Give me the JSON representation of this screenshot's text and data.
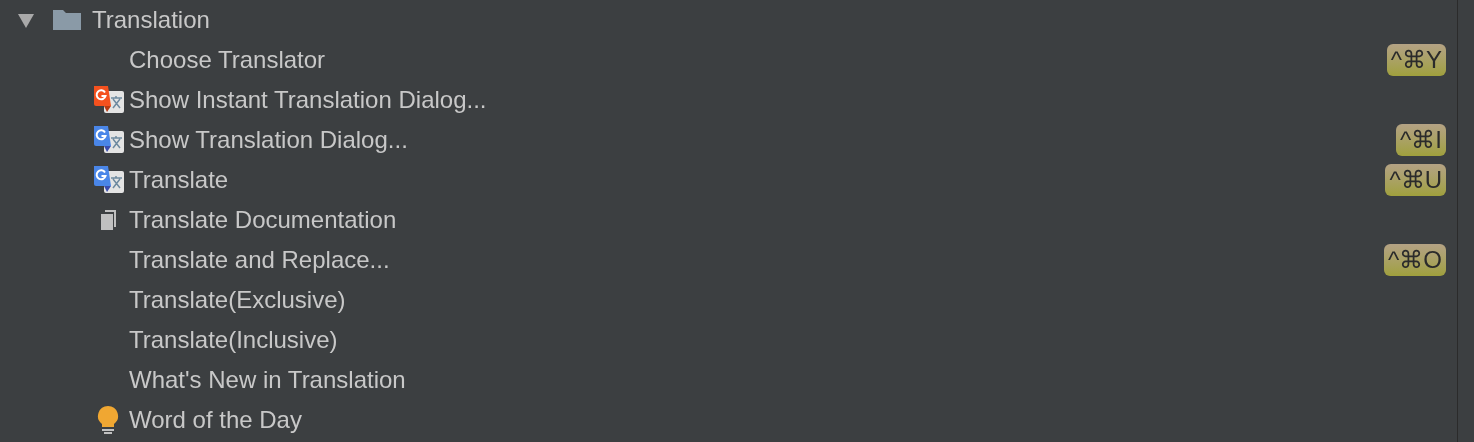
{
  "tree": {
    "label": "Translation",
    "expanded": true,
    "children": [
      {
        "label": "Choose Translator",
        "kind": "plain",
        "shortcut": "^⌘Y"
      },
      {
        "label": "Show Instant Translation Dialog...",
        "kind": "instant"
      },
      {
        "label": "Show Translation Dialog...",
        "kind": "translate",
        "shortcut": "^⌘I"
      },
      {
        "label": "Translate",
        "kind": "translate",
        "shortcut": "^⌘U"
      },
      {
        "label": "Translate Documentation",
        "kind": "document"
      },
      {
        "label": "Translate and Replace...",
        "kind": "plain",
        "shortcut": "^⌘O"
      },
      {
        "label": "Translate(Exclusive)",
        "kind": "plain"
      },
      {
        "label": "Translate(Inclusive)",
        "kind": "plain"
      },
      {
        "label": "What's New in Translation",
        "kind": "plain"
      },
      {
        "label": "Word of the Day",
        "kind": "tip"
      }
    ]
  }
}
